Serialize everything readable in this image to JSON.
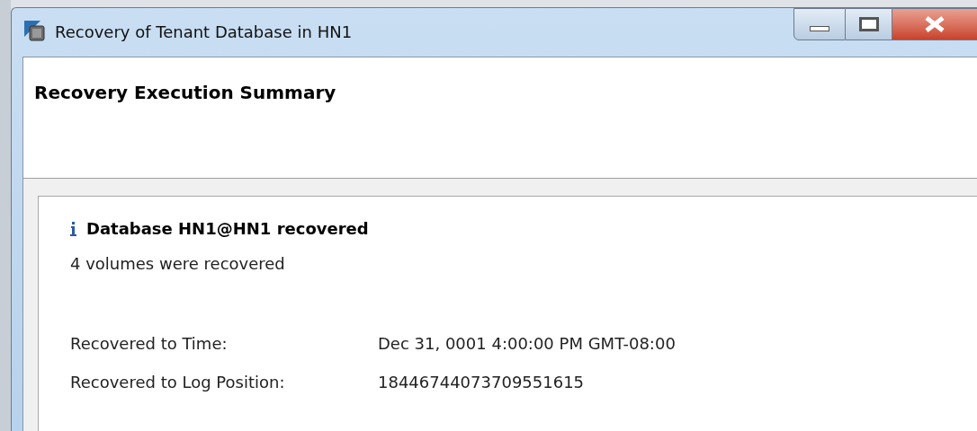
{
  "window": {
    "title": "Recovery of Tenant Database in HN1"
  },
  "header": {
    "title": "Recovery Execution Summary"
  },
  "summary": {
    "heading": "Database HN1@HN1 recovered",
    "message": "4 volumes were recovered",
    "details": [
      {
        "label": "Recovered to Time:",
        "value": "Dec 31, 0001 4:00:00 PM GMT-08:00"
      },
      {
        "label": "Recovered to Log Position:",
        "value": "18446744073709551615"
      }
    ]
  }
}
